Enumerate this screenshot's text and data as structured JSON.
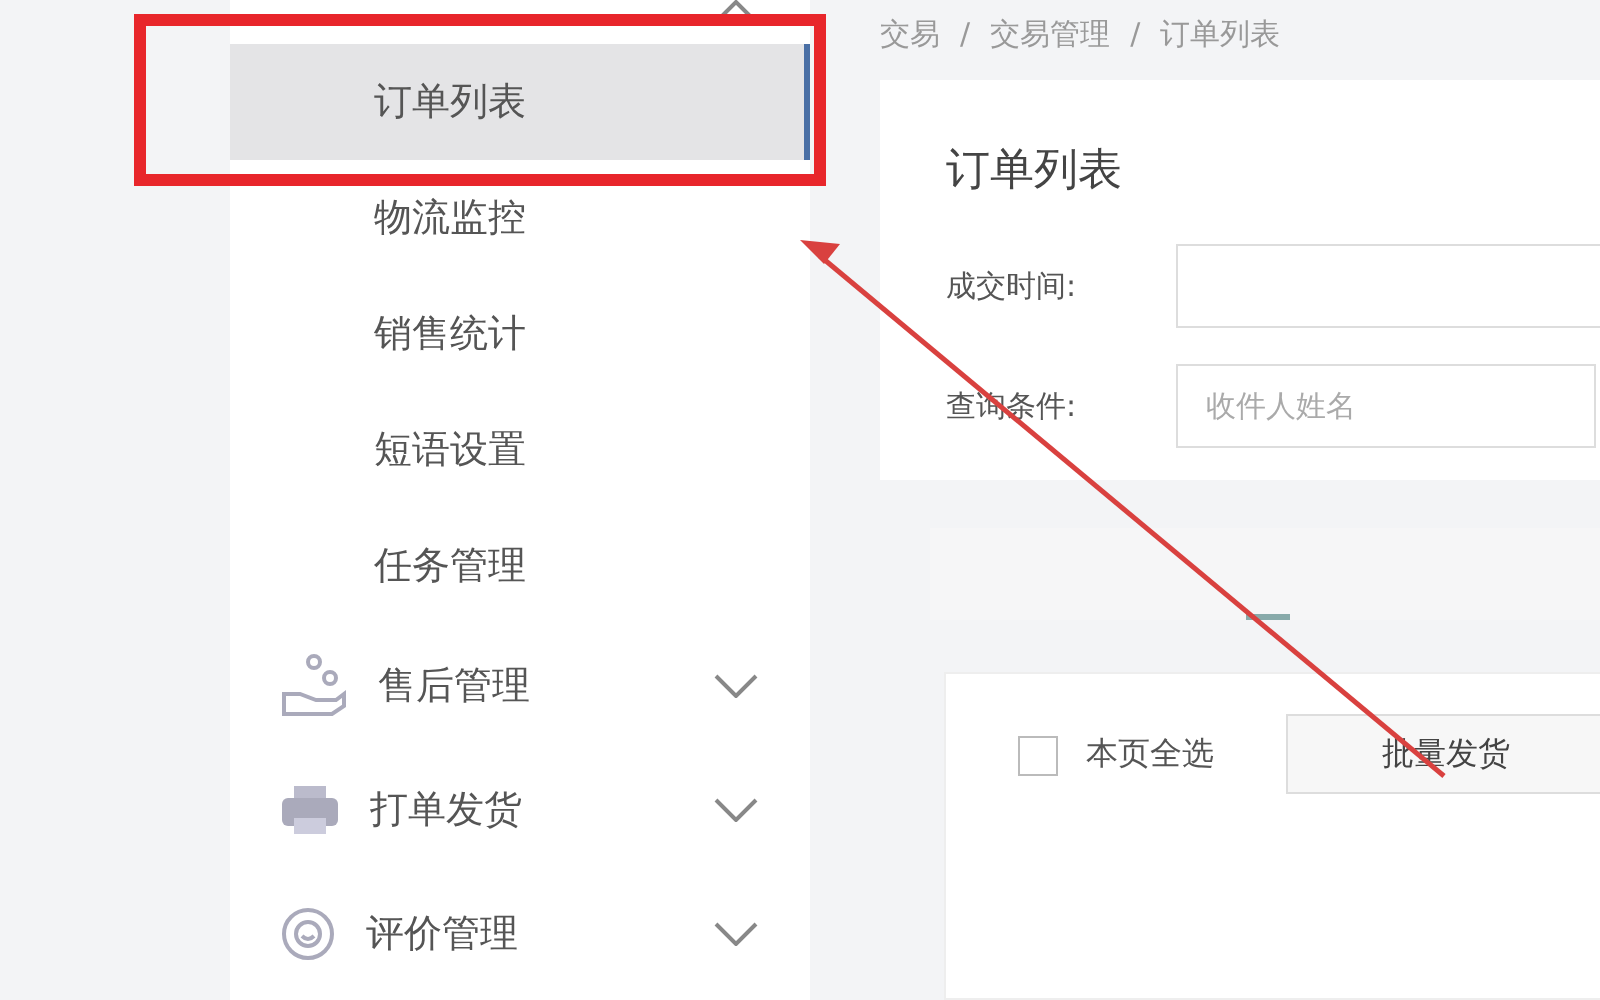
{
  "sidebar": {
    "groups": [
      {
        "expanded": true,
        "children": [
          {
            "label": "订单列表",
            "selected": true
          },
          {
            "label": "物流监控",
            "selected": false
          },
          {
            "label": "销售统计",
            "selected": false
          },
          {
            "label": "短语设置",
            "selected": false
          },
          {
            "label": "任务管理",
            "selected": false
          }
        ]
      },
      {
        "label": "售后管理",
        "expanded": false
      },
      {
        "label": "打单发货",
        "expanded": false
      },
      {
        "label": "评价管理",
        "expanded": false
      }
    ]
  },
  "breadcrumb": {
    "separator": "/",
    "items": [
      "交易",
      "交易管理",
      "订单列表"
    ]
  },
  "page_title": "订单列表",
  "filters": [
    {
      "label": "成交时间:",
      "kind": "date"
    },
    {
      "label": "查询条件:",
      "kind": "text",
      "placeholder": "收件人姓名"
    }
  ],
  "select_all": {
    "label": "本页全选",
    "checked": false
  },
  "buttons": [
    "批量发货"
  ]
}
